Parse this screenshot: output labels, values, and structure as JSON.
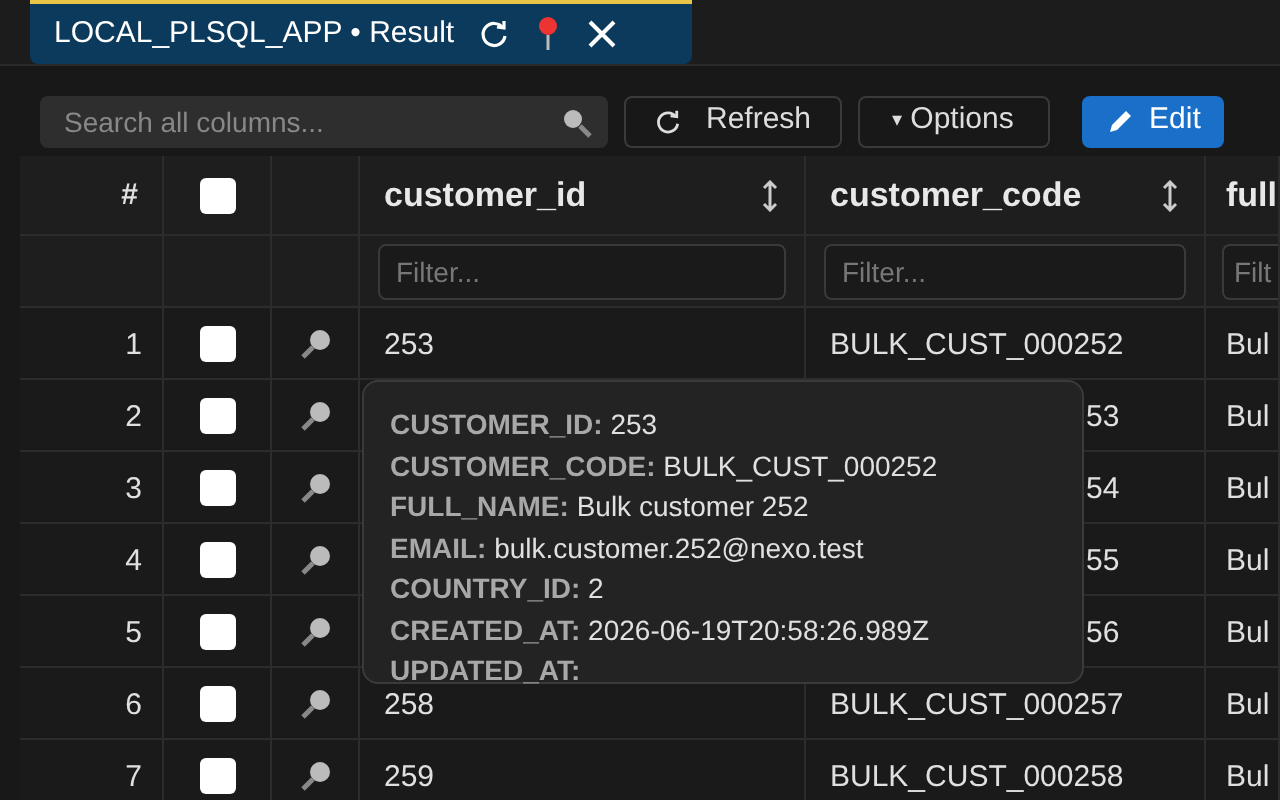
{
  "tab": {
    "title": "LOCAL_PLSQL_APP • Result"
  },
  "toolbar": {
    "search_placeholder": "Search all columns...",
    "refresh": "Refresh",
    "options": "Options",
    "options_caret": "▾",
    "edit": "Edit"
  },
  "table": {
    "columns": [
      {
        "label": "#",
        "kind": "index"
      },
      {
        "kind": "check"
      },
      {
        "kind": "icon"
      },
      {
        "label": "customer_id",
        "kind": "data",
        "placeholder": "Filter...",
        "sortable": true
      },
      {
        "label": "customer_code",
        "kind": "data",
        "placeholder": "Filter...",
        "sortable": true
      },
      {
        "label": "full",
        "kind": "data",
        "placeholder": "Filt"
      }
    ],
    "header_checked": false,
    "rows": [
      {
        "index": "1",
        "checked": false,
        "kind": "full",
        "customer_id": "253",
        "customer_code": "BULK_CUST_000252",
        "column_3": "Bul"
      },
      {
        "index": "2",
        "checked": false,
        "kind": "under_tooltip",
        "customer_code": "53",
        "column_3": "Bul"
      },
      {
        "index": "3",
        "checked": false,
        "kind": "under_tooltip",
        "customer_code": "54",
        "column_3": "Bul"
      },
      {
        "index": "4",
        "checked": false,
        "kind": "under_tooltip",
        "customer_code": "55",
        "column_3": "Bul"
      },
      {
        "index": "5",
        "checked": false,
        "kind": "under_tooltip",
        "customer_code": "56",
        "column_3": "Bul"
      },
      {
        "index": "6",
        "checked": false,
        "kind": "full",
        "customer_id": "258",
        "customer_code": "BULK_CUST_000257",
        "column_3": "Bul"
      },
      {
        "index": "7",
        "checked": false,
        "kind": "full",
        "customer_id": "259",
        "customer_code": "BULK_CUST_000258",
        "column_3": "Bul"
      }
    ]
  },
  "tooltip": [
    {
      "label": "CUSTOMER_ID:",
      "value": "253"
    },
    {
      "label": "CUSTOMER_CODE:",
      "value": "BULK_CUST_000252"
    },
    {
      "label": "FULL_NAME:",
      "value": "Bulk customer 252"
    },
    {
      "label": "EMAIL:",
      "value": "bulk.customer.252@nexo.test"
    },
    {
      "label": "COUNTRY_ID:",
      "value": "2"
    },
    {
      "label": "CREATED_AT:",
      "value": "2026-06-19T20:58:26.989Z"
    },
    {
      "label": "UPDATED_AT:"
    }
  ]
}
